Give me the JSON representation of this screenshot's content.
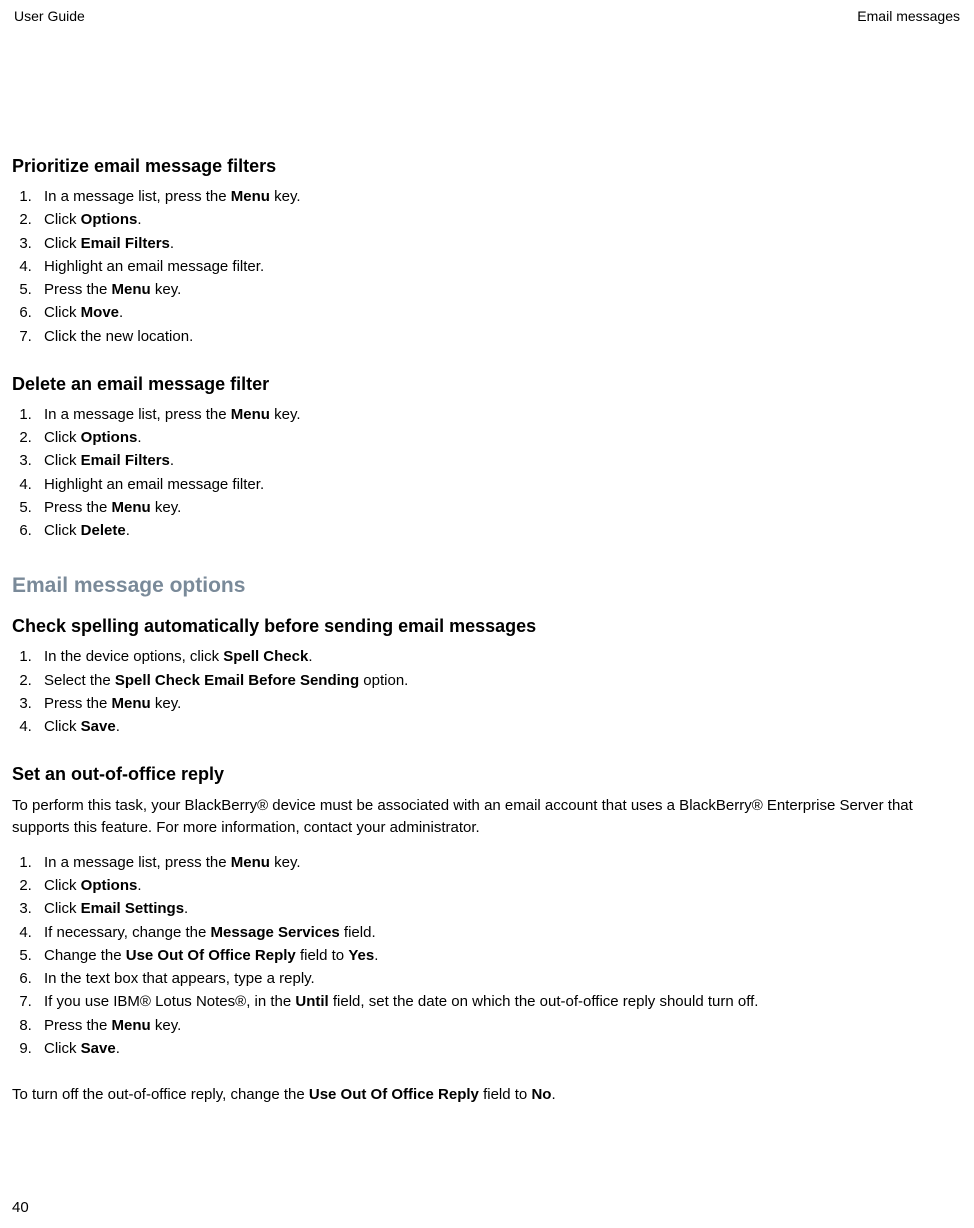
{
  "header": {
    "left": "User Guide",
    "right": "Email messages"
  },
  "footer": {
    "page_number": "40"
  },
  "sections": {
    "prioritize": {
      "title": "Prioritize email message filters",
      "steps": {
        "s1a": "In a message list, press the ",
        "s1b": "Menu",
        "s1c": " key.",
        "s2a": "Click ",
        "s2b": "Options",
        "s2c": ".",
        "s3a": "Click ",
        "s3b": "Email Filters",
        "s3c": ".",
        "s4": "Highlight an email message filter.",
        "s5a": "Press the ",
        "s5b": "Menu",
        "s5c": " key.",
        "s6a": "Click ",
        "s6b": "Move",
        "s6c": ".",
        "s7": "Click the new location."
      }
    },
    "delete_filter": {
      "title": "Delete an email message filter",
      "steps": {
        "s1a": "In a message list, press the ",
        "s1b": "Menu",
        "s1c": " key.",
        "s2a": "Click ",
        "s2b": "Options",
        "s2c": ".",
        "s3a": "Click ",
        "s3b": "Email Filters",
        "s3c": ".",
        "s4": "Highlight an email message filter.",
        "s5a": "Press the ",
        "s5b": "Menu",
        "s5c": " key.",
        "s6a": "Click ",
        "s6b": "Delete",
        "s6c": "."
      }
    },
    "options_major": {
      "title": "Email message options"
    },
    "spellcheck": {
      "title": "Check spelling automatically before sending email messages",
      "steps": {
        "s1a": "In the device options, click ",
        "s1b": "Spell Check",
        "s1c": ".",
        "s2a": "Select the ",
        "s2b": "Spell Check Email Before Sending",
        "s2c": " option.",
        "s3a": "Press the ",
        "s3b": "Menu",
        "s3c": " key.",
        "s4a": "Click ",
        "s4b": "Save",
        "s4c": "."
      }
    },
    "ooo": {
      "title": "Set an out-of-office reply",
      "intro": "To perform this task, your BlackBerry® device must be associated with an email account that uses a BlackBerry® Enterprise Server that supports this feature. For more information, contact your administrator.",
      "steps": {
        "s1a": "In a message list, press the ",
        "s1b": "Menu",
        "s1c": " key.",
        "s2a": "Click ",
        "s2b": "Options",
        "s2c": ".",
        "s3a": "Click ",
        "s3b": "Email Settings",
        "s3c": ".",
        "s4a": "If necessary, change the ",
        "s4b": "Message Services",
        "s4c": " field.",
        "s5a": "Change the ",
        "s5b": "Use Out Of Office Reply",
        "s5c": " field to ",
        "s5d": "Yes",
        "s5e": ".",
        "s6": "In the text box that appears, type a reply.",
        "s7a": "If you use IBM® Lotus Notes®, in the ",
        "s7b": "Until",
        "s7c": " field, set the date on which the out-of-office reply should turn off.",
        "s8a": "Press the ",
        "s8b": "Menu",
        "s8c": " key.",
        "s9a": "Click ",
        "s9b": "Save",
        "s9c": "."
      },
      "outro_a": "To turn off the out-of-office reply, change the ",
      "outro_b": "Use Out Of Office Reply",
      "outro_c": " field to ",
      "outro_d": "No",
      "outro_e": "."
    }
  }
}
